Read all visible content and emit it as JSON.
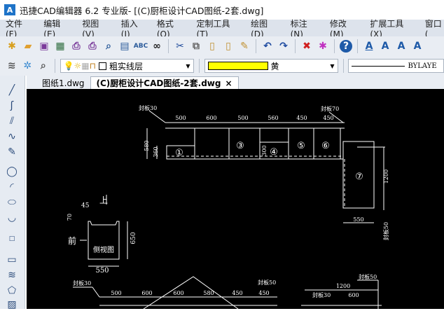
{
  "title": {
    "app": "迅捷CAD编辑器 6.2 专业版",
    "doc": " - [(C)厨柜设计CAD图纸-2套.dwg]",
    "icon": "A"
  },
  "menu": [
    "文件(F)",
    "编辑(E)",
    "视图(V)",
    "插入(I)",
    "格式(O)",
    "定制工具(T)",
    "绘图(D)",
    "标注(N)",
    "修改(M)",
    "扩展工具(X)",
    "窗口("
  ],
  "layer": {
    "name": "粗实线层"
  },
  "color": {
    "name": "黄",
    "swatch": "#ffff00"
  },
  "linetype": {
    "name": "BYLAYE"
  },
  "tabs": [
    {
      "label": "图纸1.dwg"
    },
    {
      "label": "(C)厨柜设计CAD图纸-2套.dwg",
      "close": "×"
    }
  ],
  "drawing": {
    "top_dims": [
      "500",
      "600",
      "500",
      "560",
      "450",
      "450"
    ],
    "panel_left": "封板30",
    "panel_right": "封板70",
    "h580": "580",
    "h360": "360",
    "h300": "300",
    "circles": [
      "①",
      "③",
      "④",
      "⑤",
      "⑥",
      "⑦"
    ],
    "d550": "550",
    "d1200": "1200",
    "panel50": "封板50",
    "side": {
      "label": "侧视图",
      "w": "550",
      "h": "650",
      "front": "前",
      "up": "上",
      "d45": "45",
      "d70": "70"
    },
    "bottom": {
      "panel30": "封板30",
      "dims": [
        "500",
        "600",
        "600",
        "580",
        "450",
        "450"
      ],
      "panel50": "封板50",
      "r1200": "1200",
      "r_panel50": "封板50",
      "r_panel30": "封板30",
      "r600": "600"
    }
  }
}
